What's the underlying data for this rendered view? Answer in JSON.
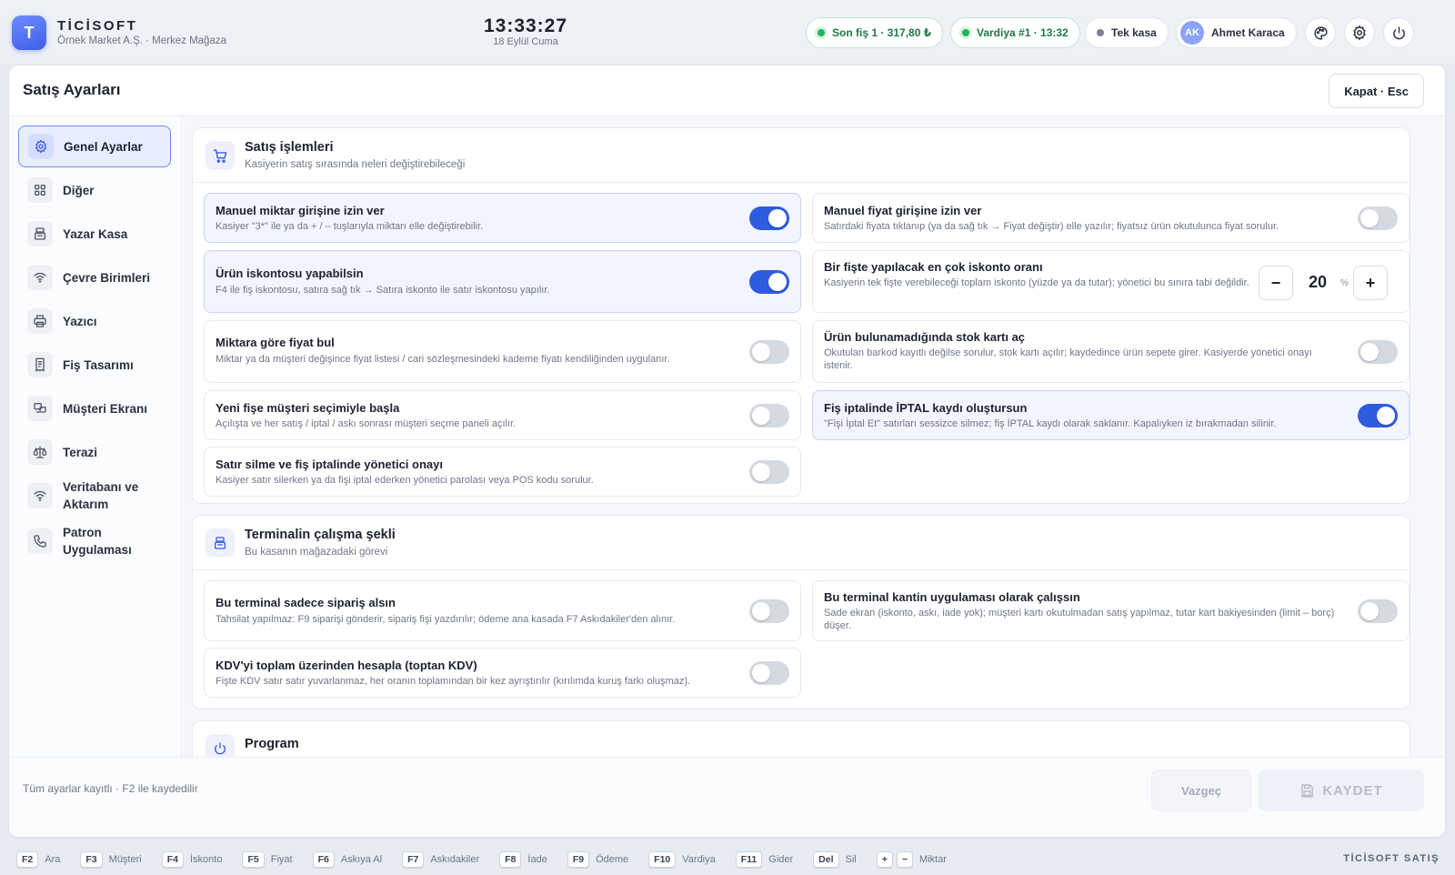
{
  "app": {
    "logo_letter": "T",
    "name": "TİCİSOFT",
    "subtitle": "Örnek Market A.Ş. · Merkez Mağaza",
    "clock": "13:33:27",
    "date": "18 Eylül Cuma"
  },
  "status": {
    "last_receipt": "Son fiş 1 · 317,80 ₺",
    "shift": "Vardiya #1 · 13:32",
    "register": "Tek kasa",
    "user_initials": "AK",
    "user_name": "Ahmet Karaca"
  },
  "colors": {
    "accent": "#2f5be0",
    "success": "#23b25f"
  },
  "panel": {
    "title": "Satış Ayarları",
    "close_label": "Kapat · Esc"
  },
  "sidebar": {
    "items": [
      {
        "label": "Genel Ayarlar",
        "icon": "gear-icon",
        "active": true
      },
      {
        "label": "Diğer",
        "icon": "grid-icon"
      },
      {
        "label": "Yazar Kasa",
        "icon": "register-icon"
      },
      {
        "label": "Çevre Birimleri",
        "icon": "wifi-icon"
      },
      {
        "label": "Yazıcı",
        "icon": "printer-icon"
      },
      {
        "label": "Fiş Tasarımı",
        "icon": "receipt-icon"
      },
      {
        "label": "Müşteri Ekranı",
        "icon": "monitor-icon"
      },
      {
        "label": "Terazi",
        "icon": "scale-icon"
      },
      {
        "label": "Veritabanı ve Aktarım",
        "icon": "wifi-icon"
      },
      {
        "label": "Patron Uygulaması",
        "icon": "phone-icon"
      }
    ]
  },
  "sections": {
    "sales": {
      "title": "Satış işlemleri",
      "subtitle": "Kasiyerin satış sırasında neleri değiştirebileceği",
      "settings": [
        {
          "title": "Manuel miktar girişine izin ver",
          "desc": "Kasiyer \"3*\" ile ya da + / – tuşlarıyla miktarı elle değiştirebilir.",
          "on": true
        },
        {
          "title": "Manuel fiyat girişine izin ver",
          "desc": "Satırdaki fiyata tıklanıp (ya da sağ tık → Fiyat değiştir) elle yazılır; fiyatsız ürün okutulunca fiyat sorulur.",
          "on": false
        },
        {
          "title": "Ürün iskontosu yapabilsin",
          "desc": "F4 ile fiş iskontosu, satıra sağ tık → Satıra iskonto ile satır iskontosu yapılır.",
          "on": true
        },
        {
          "title": "Bir fişte yapılacak en çok iskonto oranı",
          "desc": "Kasiyerin tek fişte verebileceği toplam iskonto (yüzde ya da tutar); yönetici bu sınıra tabi değildir.",
          "value": "20",
          "unit": "%",
          "minus": "−",
          "plus": "+"
        },
        {
          "title": "Miktara göre fiyat bul",
          "desc": "Miktar ya da müşteri değişince fiyat listesi / cari sözleşmesindeki kademe fiyatı kendiliğinden uygulanır.",
          "on": false
        },
        {
          "title": "Ürün bulunamadığında stok kartı aç",
          "desc": "Okutulan barkod kayıtlı değilse sorulur, stok kartı açılır; kaydedince ürün sepete girer. Kasiyerde yönetici onayı istenir.",
          "on": false
        },
        {
          "title": "Yeni fişe müşteri seçimiyle başla",
          "desc": "Açılışta ve her satış / iptal / askı sonrası müşteri seçme paneli açılır.",
          "on": false
        },
        {
          "title": "Fiş iptalinde İPTAL kaydı oluştursun",
          "desc": "\"Fişi İptal Et\" satırları sessizce silmez; fiş İPTAL kaydı olarak saklanır. Kapalıyken iz bırakmadan silinir.",
          "on": true
        },
        {
          "title": "Satır silme ve fiş iptalinde yönetici onayı",
          "desc": "Kasiyer satır silerken ya da fişi iptal ederken yönetici parolası veya POS kodu sorulur.",
          "on": false
        }
      ]
    },
    "terminal": {
      "title": "Terminalin çalışma şekli",
      "subtitle": "Bu kasanın mağazadaki görevi",
      "settings": [
        {
          "title": "Bu terminal sadece sipariş alsın",
          "desc": "Tahsilat yapılmaz: F9 siparişi gönderir, sipariş fişi yazdırılır; ödeme ana kasada F7 Askıdakiler'den alınır.",
          "on": false
        },
        {
          "title": "Bu terminal kantin uygulaması olarak çalışsın",
          "desc": "Sade ekran (iskonto, askı, iade yok); müşteri kartı okutulmadan satış yapılmaz, tutar kart bakiyesinden (limit – borç) düşer.",
          "on": false
        },
        {
          "title": "KDV'yi toplam üzerinden hesapla (toptan KDV)",
          "desc": "Fişte KDV satır satır yuvarlanmaz, her oranın toplamından bir kez ayrıştırılır (kırılımda kuruş farkı oluşmaz).",
          "on": false
        }
      ]
    },
    "program": {
      "title": "Program"
    }
  },
  "footer": {
    "status": "Tüm ayarlar kayıtlı · F2 ile kaydedilir",
    "cancel": "Vazgeç",
    "save": "KAYDET"
  },
  "shortcuts": [
    {
      "key": "F2",
      "label": "Ara"
    },
    {
      "key": "F3",
      "label": "Müşteri"
    },
    {
      "key": "F4",
      "label": "İskonto"
    },
    {
      "key": "F5",
      "label": "Fiyat"
    },
    {
      "key": "F6",
      "label": "Askıya Al"
    },
    {
      "key": "F7",
      "label": "Askıdakiler"
    },
    {
      "key": "F8",
      "label": "İade"
    },
    {
      "key": "F9",
      "label": "Ödeme"
    },
    {
      "key": "F10",
      "label": "Vardiya"
    },
    {
      "key": "F11",
      "label": "Gider"
    },
    {
      "key": "Del",
      "label": "Sil"
    },
    {
      "key": "+",
      "key2": "−",
      "label": "Miktar"
    }
  ],
  "brand_footer": "TİCİSOFT SATIŞ"
}
